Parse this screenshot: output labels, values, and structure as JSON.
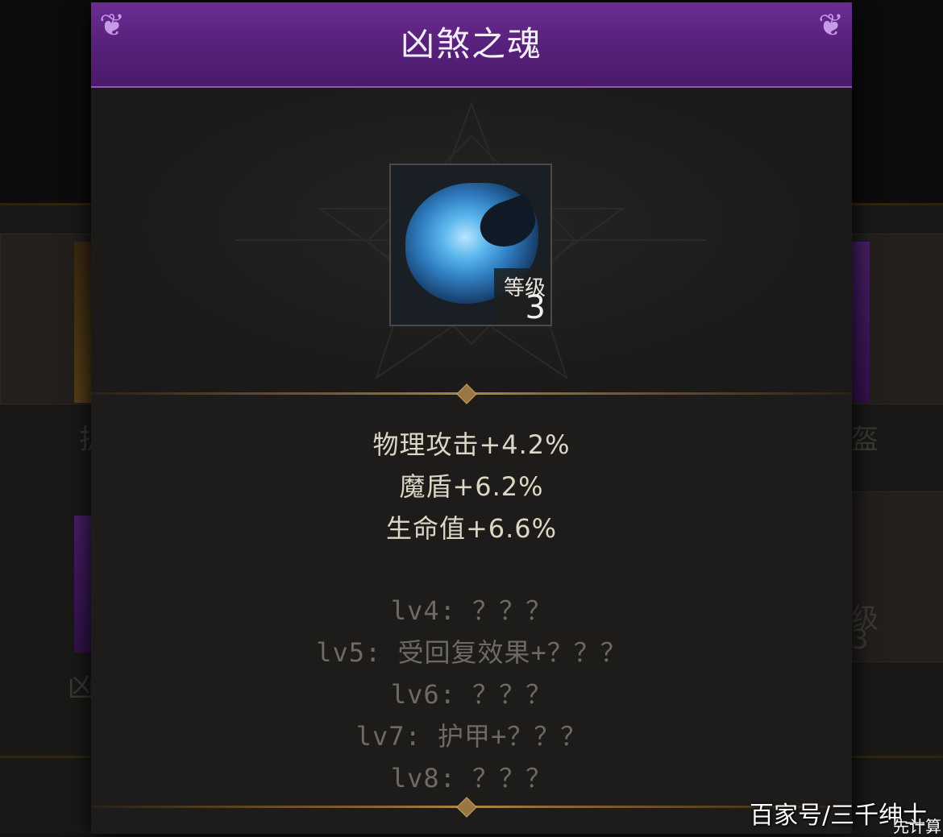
{
  "popup": {
    "title": "凶煞之魂",
    "item": {
      "icon": "blue-soul-orb-icon",
      "level_label": "等级",
      "level": "3"
    },
    "stats": [
      "物理攻击+4.2%",
      "魔盾+6.2%",
      "生命值+6.6%"
    ],
    "locked_levels": [
      "lv4: ？？？",
      "lv5: 受回复效果+？？？",
      "lv6: ？？？",
      "lv7: 护甲+？？？",
      "lv8: ？？？"
    ]
  },
  "background": {
    "left_fragments": [
      "护",
      "凶"
    ],
    "right_fragments": [
      "盔",
      "级",
      "3"
    ]
  },
  "watermark": {
    "text": "百家号/三千绅士",
    "sub": "先计算"
  },
  "colors": {
    "header_purple": "#5a2280",
    "stat_text": "#ddd6c4",
    "locked_text": "#6d6a64",
    "gold_rule": "#8d6b34"
  }
}
